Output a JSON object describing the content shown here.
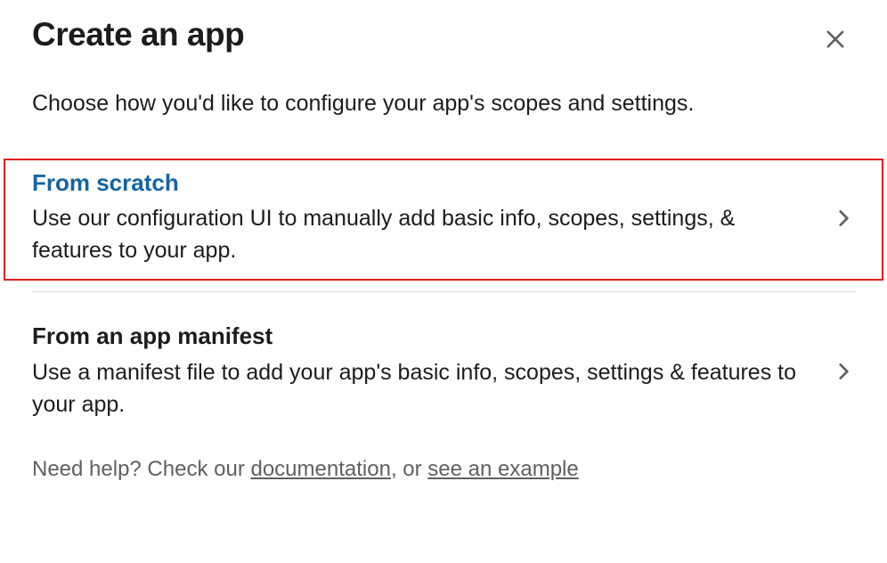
{
  "modal": {
    "title": "Create an app",
    "subtitle": "Choose how you'd like to configure your app's scopes and settings."
  },
  "options": [
    {
      "title": "From scratch",
      "description": "Use our configuration UI to manually add basic info, scopes, settings, & features to your app."
    },
    {
      "title": "From an app manifest",
      "description": "Use a manifest file to add your app's basic info, scopes, settings & features to your app."
    }
  ],
  "footer": {
    "prefix": "Need help? Check our ",
    "doc_link": "documentation",
    "middle": ", or ",
    "example_link": "see an example"
  }
}
